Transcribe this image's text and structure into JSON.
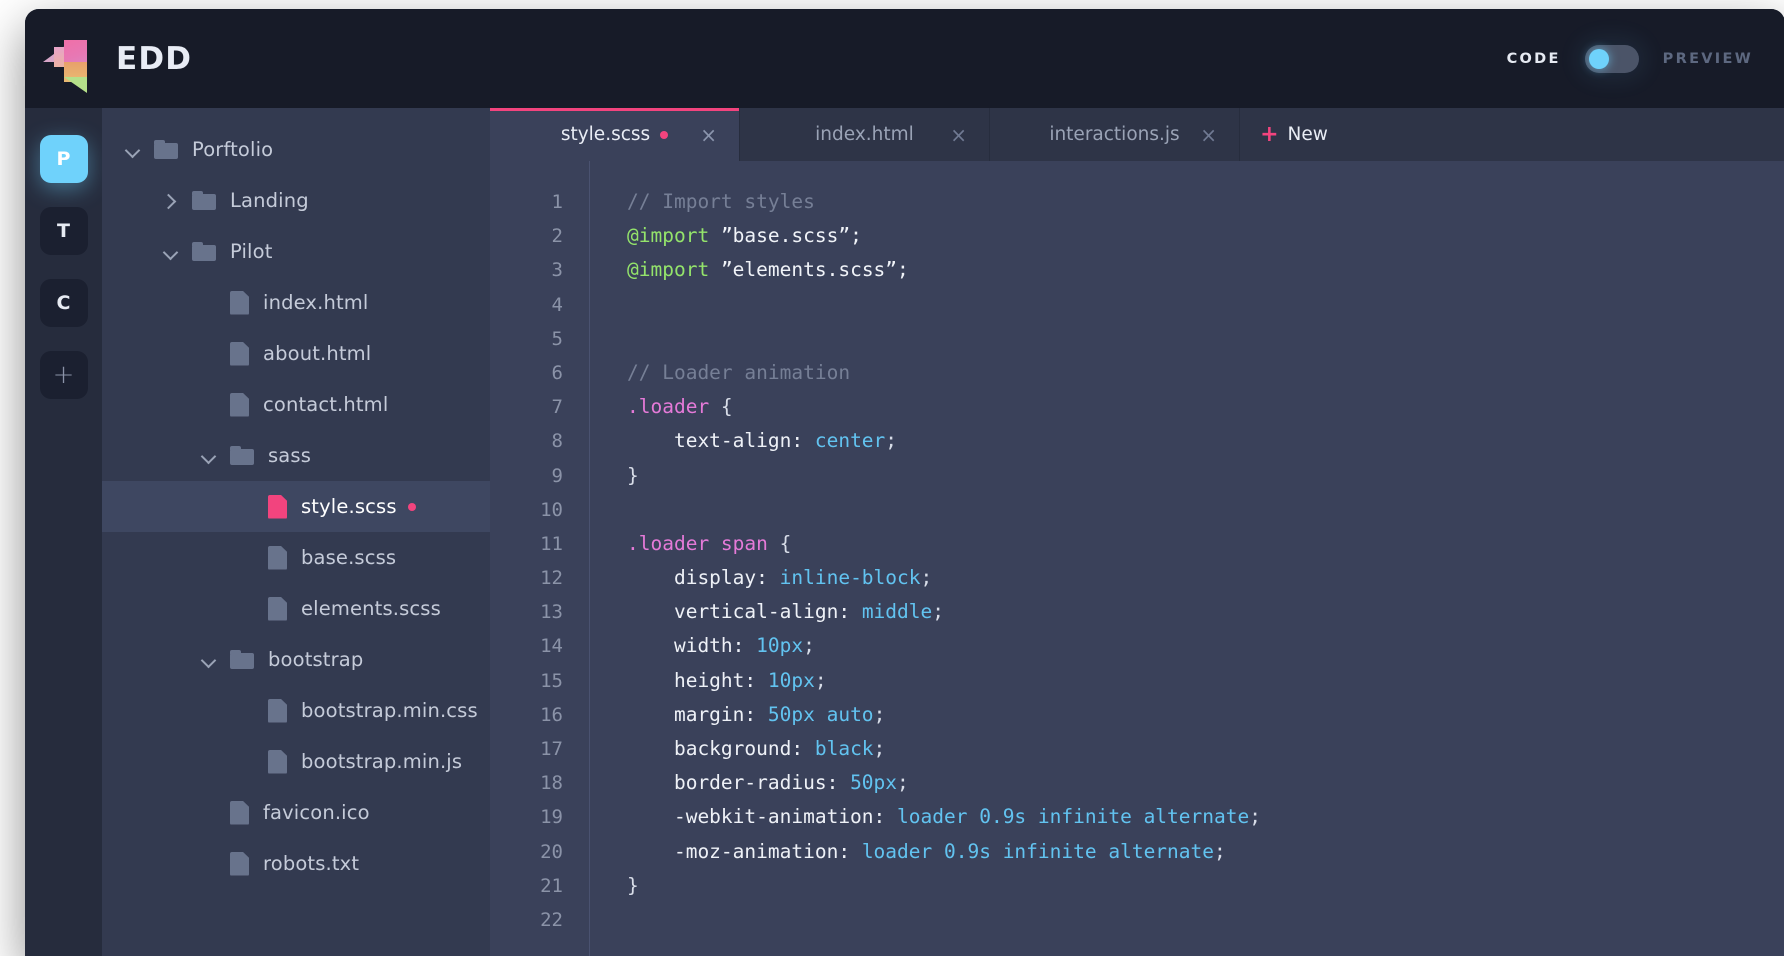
{
  "app": {
    "brand_name": "EDD",
    "logo_icon": "edd-cube-logo"
  },
  "header": {
    "code_label": "CODE",
    "preview_label": "PREVIEW",
    "toggle_state": "code",
    "toggle_accent": "#6fd2fb"
  },
  "rail": {
    "items": [
      {
        "label": "P",
        "active": true,
        "name": "workspace-p"
      },
      {
        "label": "T",
        "active": false,
        "name": "workspace-t"
      },
      {
        "label": "C",
        "active": false,
        "name": "workspace-c"
      },
      {
        "label": "+",
        "active": false,
        "name": "workspace-add"
      }
    ]
  },
  "filetree": {
    "rows": [
      {
        "label": "Porftolio",
        "type": "folder",
        "state": "open",
        "depth": 0,
        "selected": false,
        "modified": false
      },
      {
        "label": "Landing",
        "type": "folder",
        "state": "closed",
        "depth": 1,
        "selected": false,
        "modified": false
      },
      {
        "label": "Pilot",
        "type": "folder",
        "state": "open",
        "depth": 1,
        "selected": false,
        "modified": false
      },
      {
        "label": "index.html",
        "type": "file",
        "state": "none",
        "depth": 2,
        "selected": false,
        "modified": false
      },
      {
        "label": "about.html",
        "type": "file",
        "state": "none",
        "depth": 2,
        "selected": false,
        "modified": false
      },
      {
        "label": "contact.html",
        "type": "file",
        "state": "none",
        "depth": 2,
        "selected": false,
        "modified": false
      },
      {
        "label": "sass",
        "type": "folder",
        "state": "open",
        "depth": 2,
        "selected": false,
        "modified": false
      },
      {
        "label": "style.scss",
        "type": "file",
        "state": "none",
        "depth": 3,
        "selected": true,
        "modified": true
      },
      {
        "label": "base.scss",
        "type": "file",
        "state": "none",
        "depth": 3,
        "selected": false,
        "modified": false
      },
      {
        "label": "elements.scss",
        "type": "file",
        "state": "none",
        "depth": 3,
        "selected": false,
        "modified": false
      },
      {
        "label": "bootstrap",
        "type": "folder",
        "state": "open",
        "depth": 2,
        "selected": false,
        "modified": false
      },
      {
        "label": "bootstrap.min.css",
        "type": "file",
        "state": "none",
        "depth": 3,
        "selected": false,
        "modified": false
      },
      {
        "label": "bootstrap.min.js",
        "type": "file",
        "state": "none",
        "depth": 3,
        "selected": false,
        "modified": false
      },
      {
        "label": "favicon.ico",
        "type": "file",
        "state": "none",
        "depth": 2,
        "selected": false,
        "modified": false
      },
      {
        "label": "robots.txt",
        "type": "file",
        "state": "none",
        "depth": 2,
        "selected": false,
        "modified": false
      }
    ]
  },
  "tabs": {
    "items": [
      {
        "label": "style.scss",
        "active": true,
        "modified": true,
        "close": "×"
      },
      {
        "label": "index.html",
        "active": false,
        "modified": false,
        "close": "×"
      },
      {
        "label": "interactions.js",
        "active": false,
        "modified": false,
        "close": "×"
      }
    ],
    "new_label": "New",
    "new_plus": "+",
    "active_accent": "#f2447e"
  },
  "editor": {
    "language": "scss",
    "line_numbers": [
      1,
      2,
      3,
      4,
      5,
      6,
      7,
      8,
      9,
      10,
      11,
      12,
      13,
      14,
      15,
      16,
      17,
      18,
      19,
      20,
      21,
      22
    ],
    "lines": [
      [
        {
          "t": "// Import styles",
          "c": "comment"
        }
      ],
      [
        {
          "t": "@import",
          "c": "at"
        },
        {
          "t": " ",
          "c": "punc"
        },
        {
          "t": "”base.scss”;",
          "c": "string"
        }
      ],
      [
        {
          "t": "@import",
          "c": "at"
        },
        {
          "t": " ",
          "c": "punc"
        },
        {
          "t": "”elements.scss”;",
          "c": "string"
        }
      ],
      [],
      [],
      [
        {
          "t": "// Loader animation",
          "c": "comment"
        }
      ],
      [
        {
          "t": ".loader",
          "c": "sel"
        },
        {
          "t": " {",
          "c": "punc"
        }
      ],
      [
        {
          "t": "    text-align: ",
          "c": "prop"
        },
        {
          "t": "center",
          "c": "val"
        },
        {
          "t": ";",
          "c": "punc"
        }
      ],
      [
        {
          "t": "}",
          "c": "punc"
        }
      ],
      [],
      [
        {
          "t": ".loader span",
          "c": "sel"
        },
        {
          "t": " {",
          "c": "punc"
        }
      ],
      [
        {
          "t": "    display: ",
          "c": "prop"
        },
        {
          "t": "inline-block",
          "c": "val"
        },
        {
          "t": ";",
          "c": "punc"
        }
      ],
      [
        {
          "t": "    vertical-align: ",
          "c": "prop"
        },
        {
          "t": "middle",
          "c": "val"
        },
        {
          "t": ";",
          "c": "punc"
        }
      ],
      [
        {
          "t": "    width: ",
          "c": "prop"
        },
        {
          "t": "10px",
          "c": "val"
        },
        {
          "t": ";",
          "c": "punc"
        }
      ],
      [
        {
          "t": "    height: ",
          "c": "prop"
        },
        {
          "t": "10px",
          "c": "val"
        },
        {
          "t": ";",
          "c": "punc"
        }
      ],
      [
        {
          "t": "    margin: ",
          "c": "prop"
        },
        {
          "t": "50px auto",
          "c": "val"
        },
        {
          "t": ";",
          "c": "punc"
        }
      ],
      [
        {
          "t": "    background: ",
          "c": "prop"
        },
        {
          "t": "black",
          "c": "val"
        },
        {
          "t": ";",
          "c": "punc"
        }
      ],
      [
        {
          "t": "    border-radius: ",
          "c": "prop"
        },
        {
          "t": "50px",
          "c": "val"
        },
        {
          "t": ";",
          "c": "punc"
        }
      ],
      [
        {
          "t": "    -webkit-animation: ",
          "c": "prop"
        },
        {
          "t": "loader 0.9s infinite alternate",
          "c": "val"
        },
        {
          "t": ";",
          "c": "punc"
        }
      ],
      [
        {
          "t": "    -moz-animation: ",
          "c": "prop"
        },
        {
          "t": "loader 0.9s infinite alternate",
          "c": "val"
        },
        {
          "t": ";",
          "c": "punc"
        }
      ],
      [
        {
          "t": "}",
          "c": "punc"
        }
      ],
      []
    ]
  }
}
